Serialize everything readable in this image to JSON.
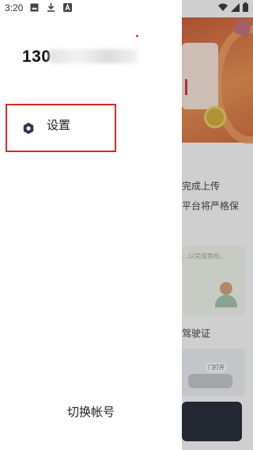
{
  "status_bar": {
    "time": "3:20",
    "icons": [
      "image-icon",
      "download-icon",
      "a-badge-icon",
      "wifi-icon",
      "signal-icon",
      "battery-icon"
    ]
  },
  "drawer": {
    "phone_prefix": "130",
    "menu": [
      {
        "label": "设置",
        "icon": "settings-gear-icon"
      }
    ],
    "switch_account_label": "切换帐号"
  },
  "background_app": {
    "texts": [
      "完成上传",
      "平台将严格保",
      "驾驶证"
    ],
    "card_note": "…以完成审核…",
    "car_tag": "门打开"
  },
  "colors": {
    "highlight_border": "#d22b2b",
    "settings_icon": "#2f3346",
    "drawer_bg": "#ffffff"
  }
}
